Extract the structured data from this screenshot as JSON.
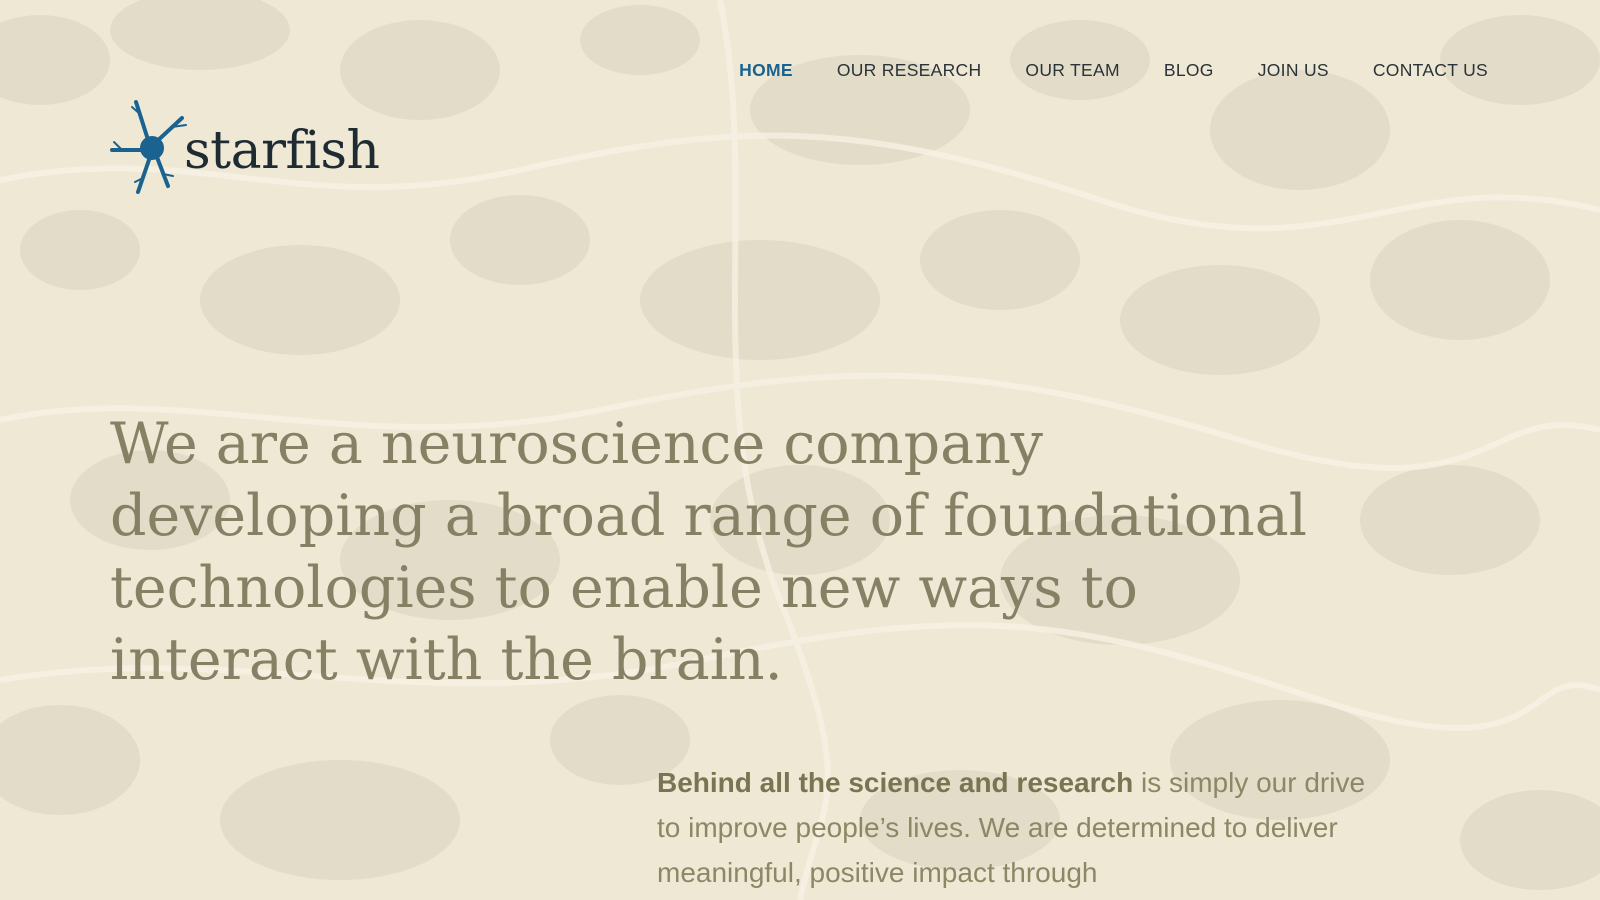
{
  "brand": {
    "name": "starfish",
    "logo_icon": "neuron-icon",
    "accent_color": "#1a6390"
  },
  "nav": {
    "items": [
      {
        "label": "HOME",
        "active": true
      },
      {
        "label": "OUR RESEARCH",
        "active": false
      },
      {
        "label": "OUR TEAM",
        "active": false
      },
      {
        "label": "BLOG",
        "active": false
      },
      {
        "label": "JOIN US",
        "active": false
      },
      {
        "label": "CONTACT US",
        "active": false
      }
    ]
  },
  "hero": {
    "headline": "We are a neuroscience company developing a broad range of foundational technologies to enable new ways to interact with the brain."
  },
  "intro": {
    "lead_bold": "Behind all the science and research",
    "text": " is simply our drive to improve people’s lives. We are determined to deliver meaningful, positive impact through"
  },
  "colors": {
    "background": "#eee8d5",
    "headline": "#878064",
    "body_text": "#8e8766",
    "nav_text": "#2a3338"
  }
}
